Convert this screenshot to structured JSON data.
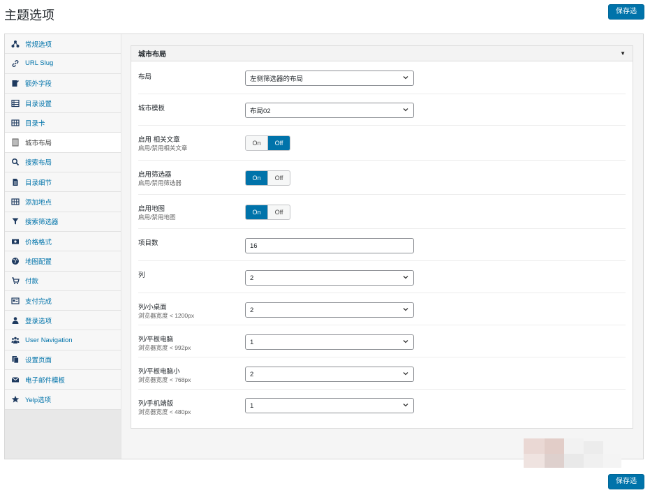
{
  "page": {
    "title": "主题选项",
    "save_label": "保存选项"
  },
  "colors": {
    "accent": "#0073aa",
    "sidebar_bg": "#e8e8e8",
    "active_item_bg": "#ffffff"
  },
  "sidebar": {
    "items": [
      {
        "label": "常规选项",
        "icon": "sitemap-icon"
      },
      {
        "label": "URL Slug",
        "icon": "link-icon"
      },
      {
        "label": "额外字段",
        "icon": "edit-icon"
      },
      {
        "label": "目录设置",
        "icon": "list-icon"
      },
      {
        "label": "目录卡",
        "icon": "grid-icon"
      },
      {
        "label": "城市布局",
        "icon": "building-icon",
        "active": true
      },
      {
        "label": "搜索布局",
        "icon": "search-icon"
      },
      {
        "label": "目录细节",
        "icon": "document-icon"
      },
      {
        "label": "添加地点",
        "icon": "grid-icon"
      },
      {
        "label": "搜索筛选器",
        "icon": "filter-icon"
      },
      {
        "label": "价格格式",
        "icon": "money-icon"
      },
      {
        "label": "地图配置",
        "icon": "globe-icon"
      },
      {
        "label": "付款",
        "icon": "cart-icon"
      },
      {
        "label": "支付完成",
        "icon": "card-icon"
      },
      {
        "label": "登录选项",
        "icon": "user-icon"
      },
      {
        "label": "User Navigation",
        "icon": "users-icon"
      },
      {
        "label": "设置页面",
        "icon": "pages-icon"
      },
      {
        "label": "电子邮件模板",
        "icon": "email-icon"
      },
      {
        "label": "Yelp选项",
        "icon": "star-icon"
      }
    ]
  },
  "section": {
    "title": "城市布局",
    "fields": {
      "layout": {
        "label": "布局",
        "value": "左侧筛选器的布局"
      },
      "city_template": {
        "label": "城市模板",
        "value": "布局02"
      },
      "related_posts": {
        "label": "启用 相关文章",
        "desc": "启用/禁用相关文章",
        "on": "On",
        "off": "Off",
        "state": "off"
      },
      "filter": {
        "label": "启用筛选器",
        "desc": "启用/禁用筛选器",
        "on": "On",
        "off": "Off",
        "state": "on"
      },
      "map": {
        "label": "启用地图",
        "desc": "启用/禁用地图",
        "on": "On",
        "off": "Off",
        "state": "on"
      },
      "item_count": {
        "label": "项目数",
        "value": "16"
      },
      "columns": {
        "label": "列",
        "value": "2"
      },
      "columns_small_desktop": {
        "label": "列/小桌面",
        "desc": "浏览器宽度 < 1200px",
        "value": "2"
      },
      "columns_tablet": {
        "label": "列/平板电脑",
        "desc": "浏览器宽度 < 992px",
        "value": "1"
      },
      "columns_small_tablet": {
        "label": "列/平板电脑小",
        "desc": "浏览器宽度 < 768px",
        "value": "2"
      },
      "columns_mobile": {
        "label": "列/手机端版",
        "desc": "浏览器宽度 < 480px",
        "value": "1"
      }
    }
  }
}
